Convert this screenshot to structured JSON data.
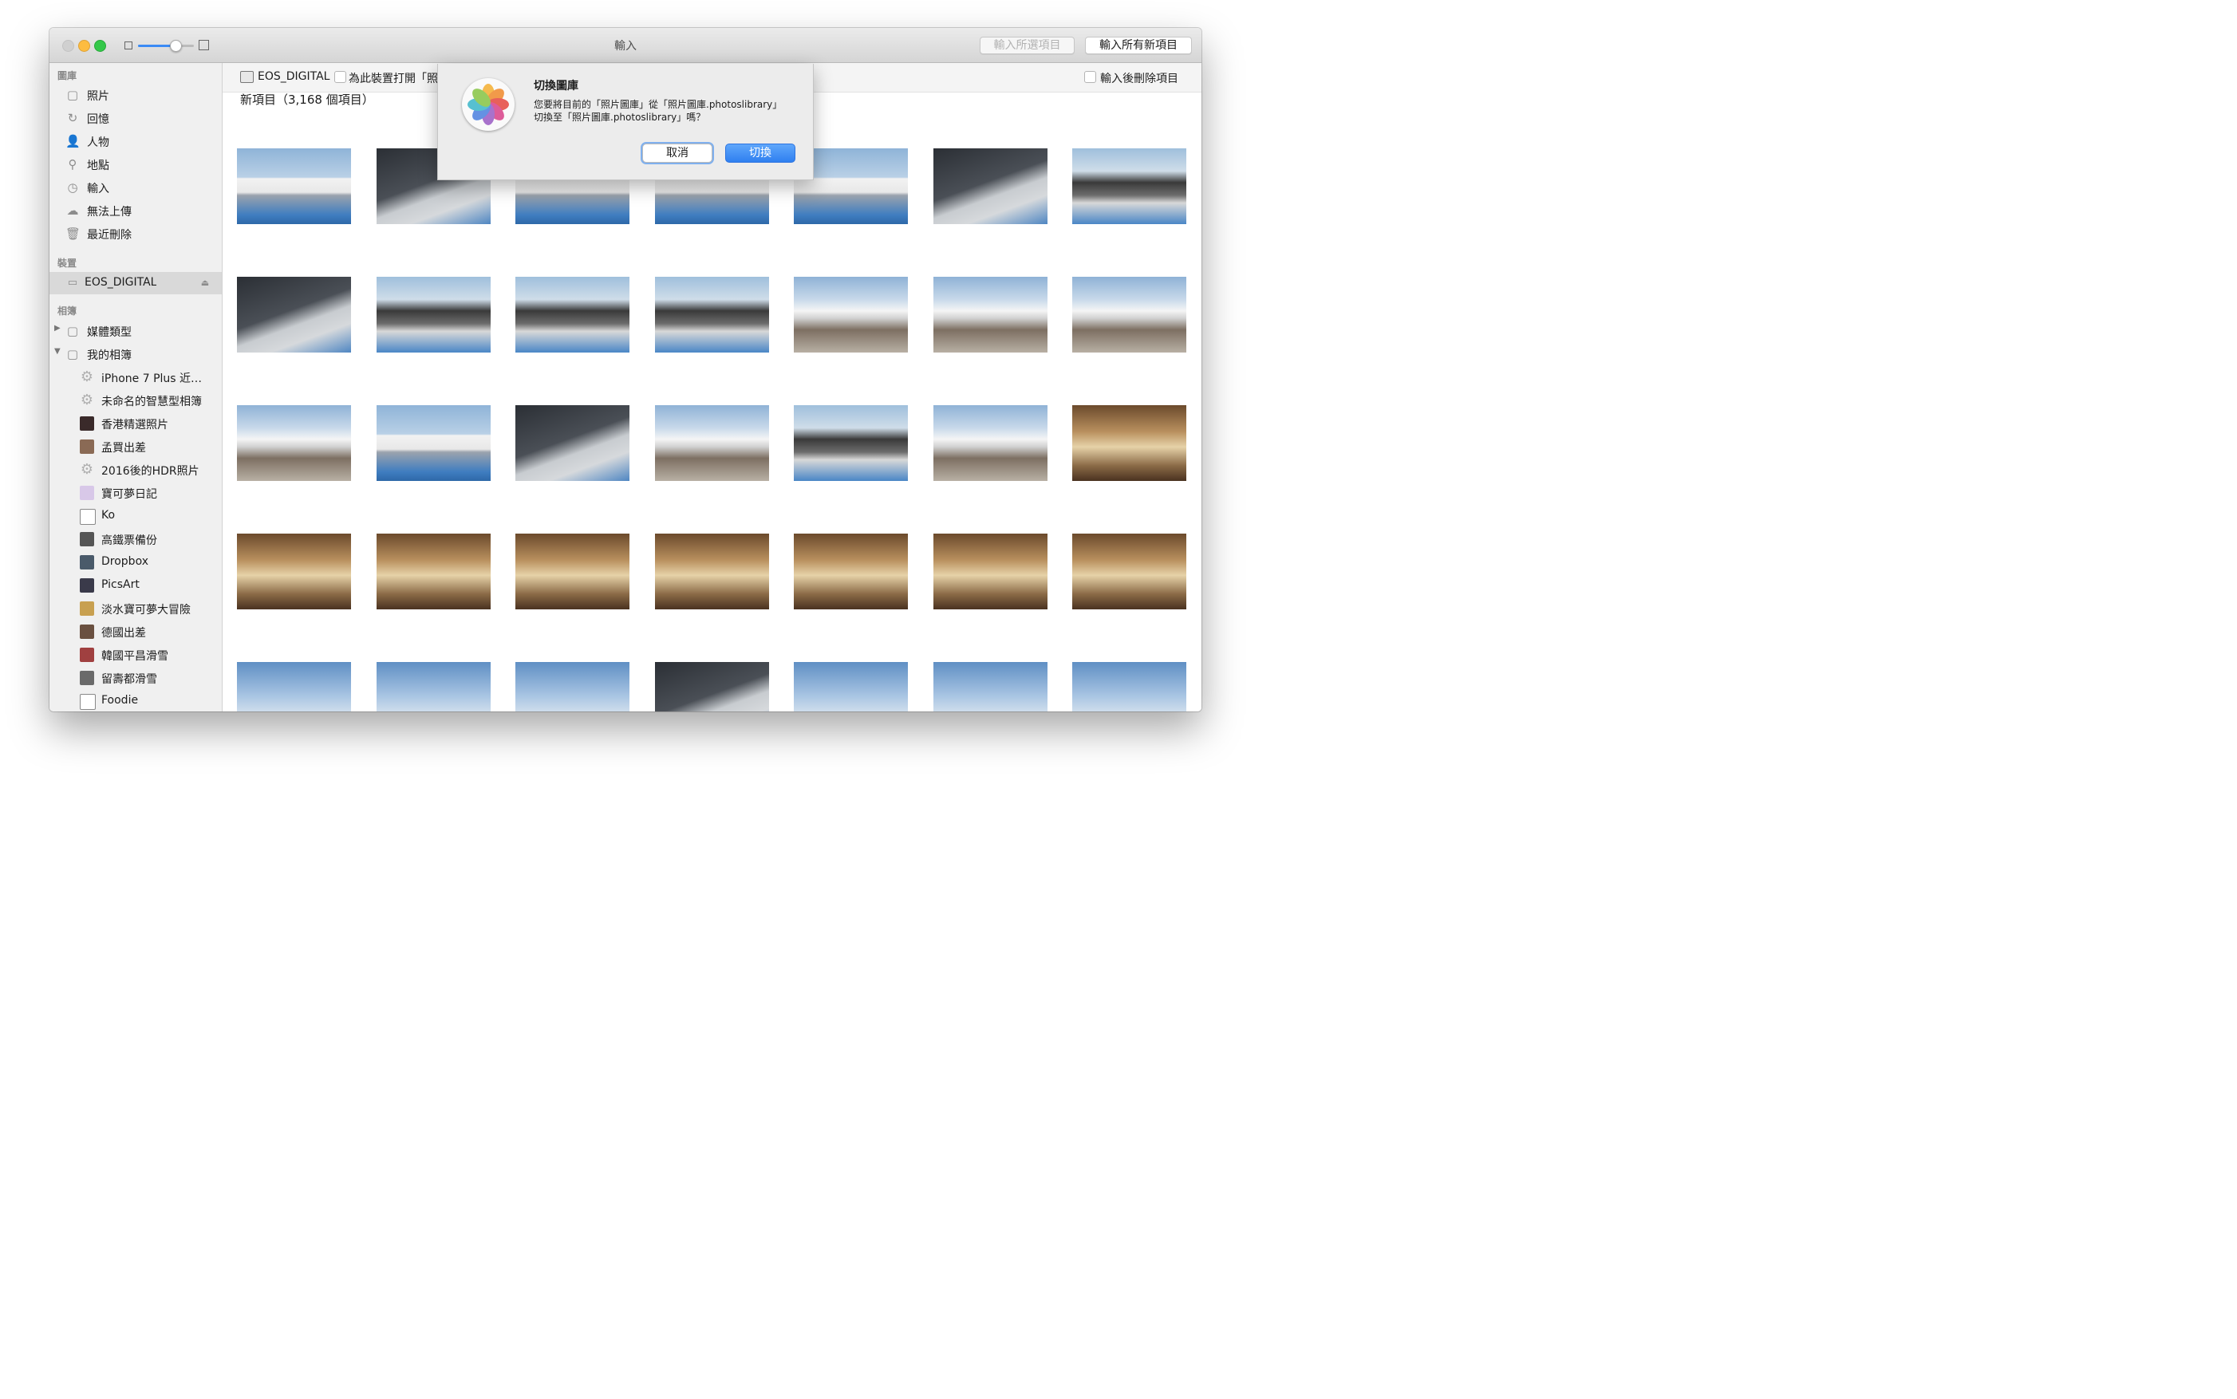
{
  "window": {
    "title": "輸入"
  },
  "toolbar": {
    "import_selected_label": "輸入所選項目",
    "import_all_label": "輸入所有新項目",
    "zoom_level": 0.65
  },
  "sidebar": {
    "library_header": "圖庫",
    "library_items": [
      {
        "label": "照片",
        "icon": "photos-icon",
        "glyph": "▢"
      },
      {
        "label": "回憶",
        "icon": "memories-icon",
        "glyph": "↻"
      },
      {
        "label": "人物",
        "icon": "people-icon",
        "glyph": "👤"
      },
      {
        "label": "地點",
        "icon": "pin-icon",
        "glyph": "⚲"
      },
      {
        "label": "輸入",
        "icon": "clock-icon",
        "glyph": "◷"
      },
      {
        "label": "無法上傳",
        "icon": "cloud-icon",
        "glyph": "☁"
      },
      {
        "label": "最近刪除",
        "icon": "trash-icon",
        "glyph": "🗑"
      }
    ],
    "devices_header": "裝置",
    "device": {
      "label": "EOS_DIGITAL",
      "eject_glyph": "⏏"
    },
    "albums_header": "相簿",
    "album_groups": [
      {
        "label": "媒體類型",
        "expanded": false,
        "triangle": "▶"
      },
      {
        "label": "我的相簿",
        "expanded": true,
        "triangle": "▼"
      }
    ],
    "albums": [
      {
        "label": "iPhone 7 Plus 近…",
        "icon": "gear-icon",
        "color": "#b0b0b0"
      },
      {
        "label": "未命名的智慧型相簿",
        "icon": "gear-icon",
        "color": "#b0b0b0"
      },
      {
        "label": "香港精選照片",
        "icon": "album-thumbnail",
        "color": "#3a2a2a"
      },
      {
        "label": "孟買出差",
        "icon": "album-thumbnail",
        "color": "#8a6a55"
      },
      {
        "label": "2016後的HDR照片",
        "icon": "gear-icon",
        "color": "#b0b0b0"
      },
      {
        "label": "寶可夢日記",
        "icon": "album-thumbnail",
        "color": "#d8c8e8"
      },
      {
        "label": "Ko",
        "icon": "album-icon",
        "color": "#ffffff"
      },
      {
        "label": "高鐵票備份",
        "icon": "album-thumbnail",
        "color": "#555555"
      },
      {
        "label": "Dropbox",
        "icon": "album-thumbnail",
        "color": "#4a5a6a"
      },
      {
        "label": "PicsArt",
        "icon": "album-thumbnail",
        "color": "#3a3a4a"
      },
      {
        "label": "淡水寶可夢大冒險",
        "icon": "album-thumbnail",
        "color": "#c8a050"
      },
      {
        "label": "德國出差",
        "icon": "album-thumbnail",
        "color": "#6a5040"
      },
      {
        "label": "韓國平昌滑雪",
        "icon": "album-thumbnail",
        "color": "#a04040"
      },
      {
        "label": "留壽都滑雪",
        "icon": "album-thumbnail",
        "color": "#6a6a6a"
      },
      {
        "label": "Foodie",
        "icon": "album-icon",
        "color": "#ffffff"
      }
    ]
  },
  "import_bar": {
    "device_name": "EOS_DIGITAL",
    "open_for_device_label": "為此裝置打開「照",
    "delete_after_label": "輸入後刪除項目"
  },
  "main": {
    "new_items_label": "新項目（3,168 個項目）"
  },
  "photos": [
    "yacht",
    "hall",
    "yacht",
    "yacht",
    "yacht",
    "hall",
    "event",
    "hall",
    "event",
    "event",
    "event",
    "people",
    "people",
    "people",
    "people",
    "yacht",
    "hall",
    "people",
    "event",
    "people",
    "room",
    "room",
    "room",
    "room",
    "room",
    "room",
    "room",
    "room",
    "sky",
    "sky",
    "sky",
    "hall",
    "sky",
    "sky",
    "sky"
  ],
  "dialog": {
    "title": "切換圖庫",
    "message": "您要將目前的「照片圖庫」從「照片圖庫.photoslibrary」切換至「照片圖庫.photoslibrary」嗎？",
    "cancel_label": "取消",
    "switch_label": "切換"
  },
  "colors": {
    "accent": "#3b8bf5",
    "close": "#d0d0d0",
    "minimize": "#fdbc40",
    "maximize": "#34c84a"
  }
}
